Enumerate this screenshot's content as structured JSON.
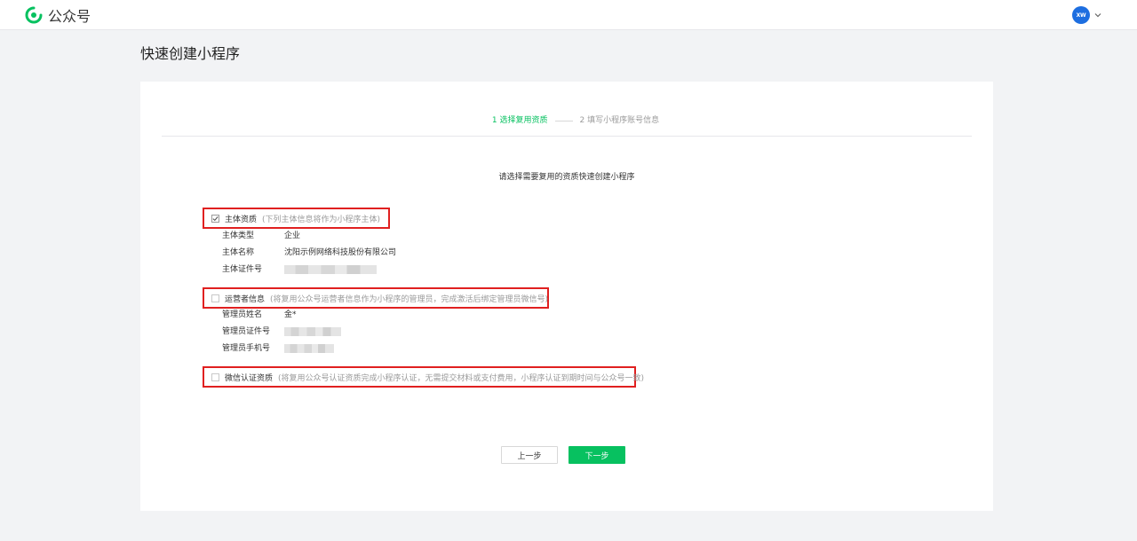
{
  "header": {
    "logo_text": "公众号",
    "avatar_text": "XW"
  },
  "page": {
    "title": "快速创建小程序"
  },
  "steps": [
    {
      "label": "1 选择复用资质",
      "active": true
    },
    {
      "label": "2 填写小程序账号信息",
      "active": false
    }
  ],
  "instruction": "请选择需要复用的资质快速创建小程序",
  "sections": [
    {
      "title": "主体资质",
      "hint": "(下列主体信息将作为小程序主体)",
      "checked": true,
      "fields": [
        {
          "label": "主体类型",
          "value": "企业"
        },
        {
          "label": "主体名称",
          "value": "沈阳示例网络科技股份有限公司"
        },
        {
          "label": "主体证件号",
          "value": ""
        }
      ]
    },
    {
      "title": "运营者信息",
      "hint": "(将复用公众号运营者信息作为小程序的管理员，完成激活后绑定管理员微信号)",
      "checked": false,
      "fields": [
        {
          "label": "管理员姓名",
          "value": "金*"
        },
        {
          "label": "管理员证件号",
          "value": ""
        },
        {
          "label": "管理员手机号",
          "value": ""
        }
      ]
    },
    {
      "title": "微信认证资质",
      "hint": "(将复用公众号认证资质完成小程序认证，无需提交材料或支付费用，小程序认证到期时间与公众号一致)",
      "checked": false,
      "fields": []
    }
  ],
  "buttons": {
    "prev": "上一步",
    "next": "下一步"
  },
  "colors": {
    "accent": "#07c160",
    "highlight_border": "#e02020"
  }
}
